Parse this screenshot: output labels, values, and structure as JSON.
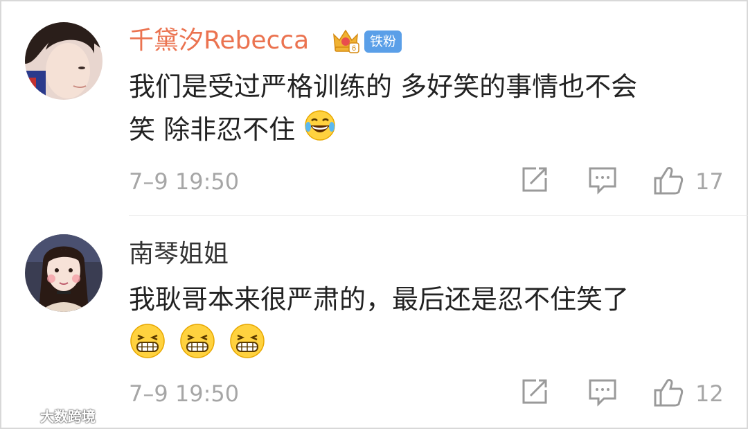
{
  "comments": [
    {
      "username": "千黛汐Rebecca",
      "badge": "铁粉",
      "line1": "我们是受过严格训练的 多好笑的事情也不会",
      "line2": "笑 除非忍不住",
      "emoji_names": [
        "laughing-tears-icon"
      ],
      "time": "7–9 19:50",
      "likes": "17",
      "avatar": "avatar-girl-1"
    },
    {
      "username": "南琴姐姐",
      "line1": "我耿哥本来很严肃的，最后还是忍不住笑了",
      "emoji_names": [
        "grin-icon",
        "grin-icon",
        "grin-icon"
      ],
      "time": "7–9 19:50",
      "likes": "12",
      "avatar": "avatar-girl-2"
    }
  ],
  "watermark": "大数跨境",
  "colors": {
    "username_accent": "#eb7350",
    "badge": "#5a9fe8",
    "meta": "#a6a6a6"
  }
}
